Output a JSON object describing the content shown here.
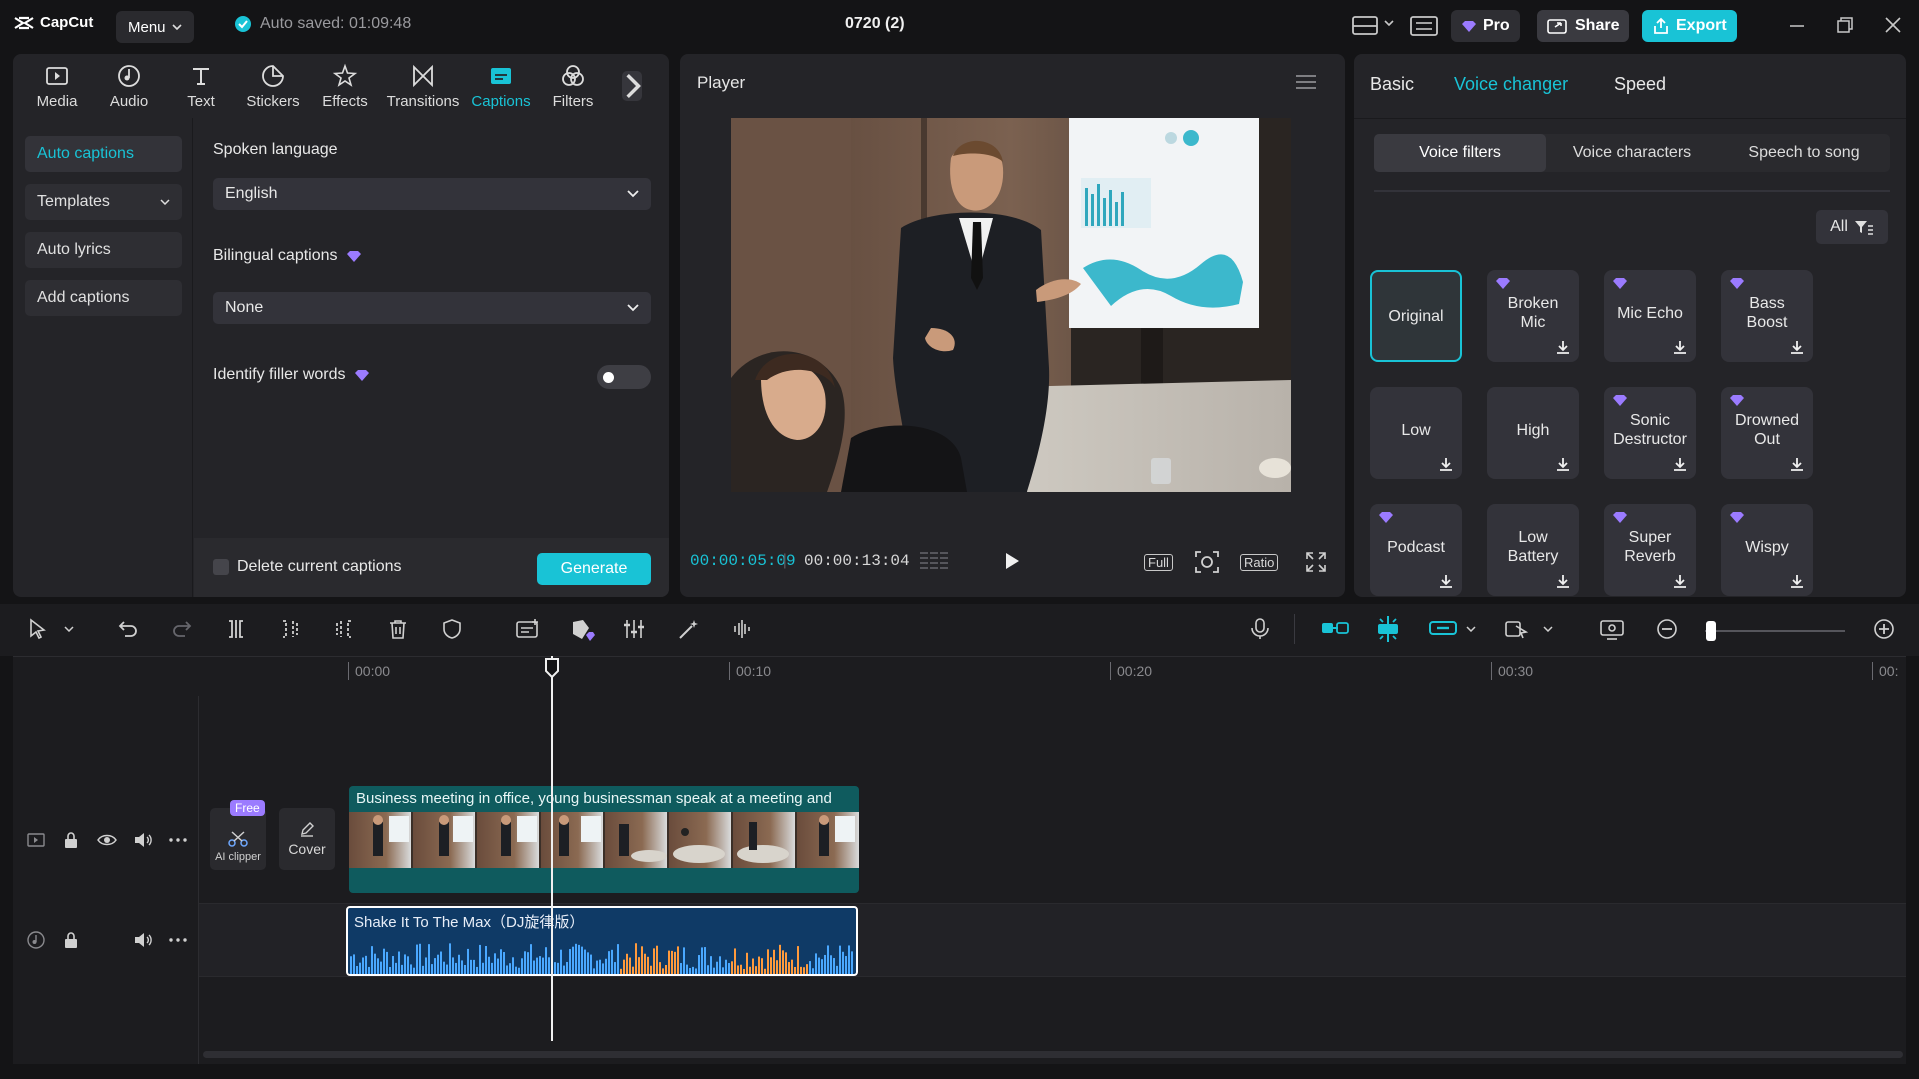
{
  "app": {
    "name": "CapCut",
    "menu_label": "Menu",
    "autosave": "Auto saved: 01:09:48",
    "project_title": "0720 (2)",
    "pro_label": "Pro",
    "share_label": "Share",
    "export_label": "Export",
    "accent": "#19c3d6"
  },
  "tools": [
    {
      "label": "Media",
      "icon": "media-icon"
    },
    {
      "label": "Audio",
      "icon": "audio-icon"
    },
    {
      "label": "Text",
      "icon": "text-icon"
    },
    {
      "label": "Stickers",
      "icon": "stickers-icon"
    },
    {
      "label": "Effects",
      "icon": "effects-icon"
    },
    {
      "label": "Transitions",
      "icon": "transitions-icon"
    },
    {
      "label": "Captions",
      "icon": "captions-icon",
      "active": true
    },
    {
      "label": "Filters",
      "icon": "filters-icon"
    }
  ],
  "captions_nav": {
    "auto_captions": "Auto captions",
    "templates": "Templates",
    "auto_lyrics": "Auto lyrics",
    "add_captions": "Add captions"
  },
  "captions_form": {
    "spoken_language_label": "Spoken language",
    "spoken_language_value": "English",
    "bilingual_label": "Bilingual captions",
    "bilingual_value": "None",
    "filler_label": "Identify filler words",
    "filler_enabled": false,
    "delete_label": "Delete current captions",
    "generate_label": "Generate"
  },
  "player": {
    "title": "Player",
    "current_time": "00:00:05:09",
    "total_time": "00:00:13:04",
    "full_label": "Full",
    "ratio_label": "Ratio"
  },
  "right_panel": {
    "tabs": [
      "Basic",
      "Voice changer",
      "Speed"
    ],
    "active_tab": "Voice changer",
    "subtabs": [
      "Voice filters",
      "Voice characters",
      "Speech to song"
    ],
    "active_subtab": "Voice filters",
    "filter_label": "All",
    "voices": [
      {
        "label": "Original",
        "pro": false,
        "download": false,
        "active": true
      },
      {
        "label": "Broken Mic",
        "pro": true,
        "download": true
      },
      {
        "label": "Mic Echo",
        "pro": true,
        "download": true
      },
      {
        "label": "Bass Boost",
        "pro": true,
        "download": true
      },
      {
        "label": "Low",
        "pro": false,
        "download": true
      },
      {
        "label": "High",
        "pro": false,
        "download": true
      },
      {
        "label": "Sonic Destructor",
        "pro": true,
        "download": true
      },
      {
        "label": "Drowned Out",
        "pro": true,
        "download": true
      },
      {
        "label": "Podcast",
        "pro": true,
        "download": true
      },
      {
        "label": "Low Battery",
        "pro": false,
        "download": true
      },
      {
        "label": "Super Reverb",
        "pro": true,
        "download": true
      },
      {
        "label": "Wispy",
        "pro": true,
        "download": true
      }
    ]
  },
  "timeline": {
    "ruler": [
      "00:00",
      "00:10",
      "00:20",
      "00:30",
      "00:"
    ],
    "video_clip_title": "Business meeting in office, young businessman speak at a meeting and",
    "audio_clip_title": "Shake It To The Max（DJ旋律版）",
    "ai_clipper_badge": "Free",
    "ai_clipper_label": "AI clipper",
    "cover_label": "Cover",
    "zoom_level": 0.04
  }
}
